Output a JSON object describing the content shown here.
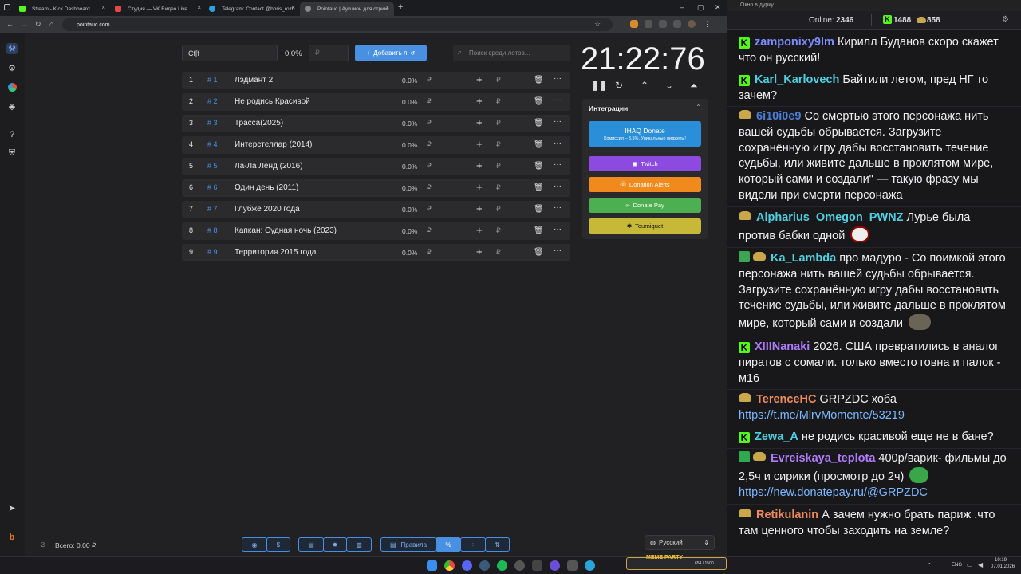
{
  "browser": {
    "tabs": [
      {
        "title": "Stream - Kick Dashboard",
        "favicon_color": "#53fc18"
      },
      {
        "title": "Студия — VK Видео Live",
        "favicon_color": "#e64646"
      },
      {
        "title": "Telegram: Contact @boris_rozh",
        "favicon_color": "#2aa3dd"
      },
      {
        "title": "Pointauc | Аукцион для стрим",
        "favicon_color": "#888888"
      }
    ],
    "url": "pointauc.com"
  },
  "auction": {
    "lot_input_value": "Cf[f",
    "percent": "0.0%",
    "amount_placeholder": "₽",
    "add_button": "Добавить л",
    "search_placeholder": "Поиск среди лотов...",
    "lots": [
      {
        "num": "1",
        "id": "# 1",
        "name": "Лэдмант 2",
        "pct": "0.0%"
      },
      {
        "num": "2",
        "id": "# 2",
        "name": "Не родись Красивой",
        "pct": "0.0%"
      },
      {
        "num": "3",
        "id": "# 3",
        "name": "Трасса(2025)",
        "pct": "0.0%"
      },
      {
        "num": "4",
        "id": "# 4",
        "name": "Интерстеллар (2014)",
        "pct": "0.0%"
      },
      {
        "num": "5",
        "id": "# 5",
        "name": "Ла-Ла Ленд (2016)",
        "pct": "0.0%"
      },
      {
        "num": "6",
        "id": "# 6",
        "name": "Один день (2011)",
        "pct": "0.0%"
      },
      {
        "num": "7",
        "id": "# 7",
        "name": "Глубже 2020 года",
        "pct": "0.0%"
      },
      {
        "num": "8",
        "id": "# 8",
        "name": "Капкан: Судная ночь (2023)",
        "pct": "0.0%"
      },
      {
        "num": "9",
        "id": "# 9",
        "name": "Территория 2015 года",
        "pct": "0.0%"
      }
    ],
    "currency": "₽",
    "timer": "21:22:76",
    "integrations_title": "Интеграции",
    "integrations": {
      "ihaq_title": "IHAQ Donate",
      "ihaq_sub": "Комиссия – 3,5%. Уникальные виджеты!",
      "twitch": "Twitch",
      "donation_alerts": "Donation Alerts",
      "donate_pay": "Donate Pay",
      "tourniquet": "Tourniquet"
    },
    "total": "Всего: 0,00 ₽",
    "rules": "Правила",
    "language": "Русский"
  },
  "chat": {
    "window_title": "Окно в дурку",
    "online_label": "Online:",
    "online_count": "2346",
    "kick_count": "1488",
    "other_count": "858",
    "messages": [
      {
        "user": "zamponixy9lm",
        "color": "#7c8cff",
        "text": "Кирилл Буданов скоро скажет что он русский!"
      },
      {
        "user": "Karl_Karlovech",
        "color": "#4fd0e0",
        "text": "Байтили летом, пред НГ то зачем?"
      },
      {
        "user": "6i10i0e9",
        "color": "#4a7fd8",
        "text": "Со смертью этого персонажа нить вашей судьбы обрывается. Загрузите сохранённую игру дабы восстановить течение судьбы, или живите дальше в проклятом мире, который сами и создали\" — такую фразу мы видели при смерти персонажа"
      },
      {
        "user": "Alpharius_Omegon_PWNZ",
        "color": "#4fd0e0",
        "text": "Лурье была против бабки одной"
      },
      {
        "user": "Ka_Lambda",
        "color": "#4fd0e0",
        "text": "про мадуро - Со поимкой этого персонажа нить вашей судьбы обрывается. Загрузите сохранённую игру дабы восстановить течение судьбы, или живите дальше в проклятом мире, который сами и создали"
      },
      {
        "user": "XIIINanaki",
        "color": "#b07cff",
        "text": "2026. США превратились в аналог пиратов с сомали. только вместо говна и палок - м16"
      },
      {
        "user": "TerenceHC",
        "color": "#f08a5d",
        "text": "GRPZDC хоба",
        "link": "https://t.me/MlrvMomente/53219"
      },
      {
        "user": "Zewa_A",
        "color": "#4fd0e0",
        "text": "не родись красивой еще не в бане?"
      },
      {
        "user": "Evreiskaya_teplota",
        "color": "#b07cff",
        "text": "400р/варик- фильмы до 2,5ч и сирики (просмотр до 2ч)",
        "link": "https://new.donatepay.ru/@GRPZDC"
      },
      {
        "user": "Retikulanin",
        "color": "#f08a5d",
        "text": "А зачем нужно брать париж .что там ценного чтобы заходить на земле?"
      }
    ]
  },
  "taskbar": {
    "media_label": "MEME PARTY",
    "media_progress": "654 / 1500",
    "lang": "ENG",
    "time": "19:19",
    "date": "07.01.2026"
  }
}
